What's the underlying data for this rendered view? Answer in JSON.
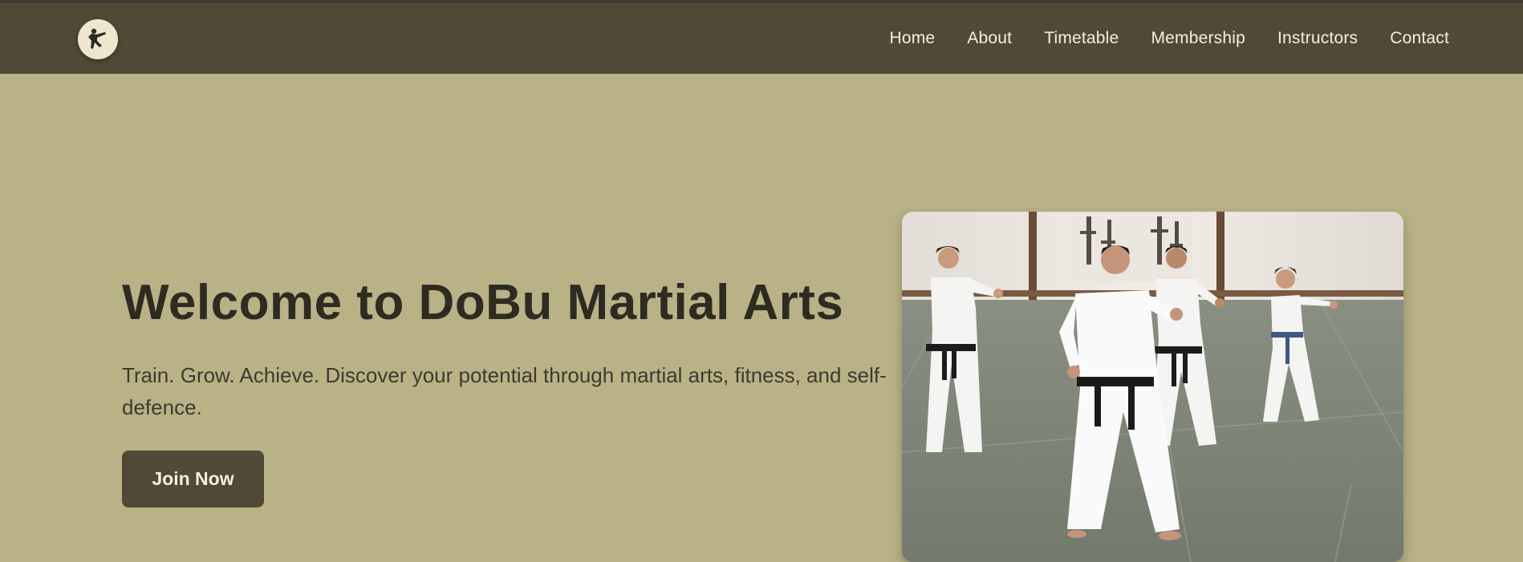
{
  "brand": {
    "logo_icon": "martial-artist-kick-icon"
  },
  "nav": {
    "items": [
      {
        "label": "Home"
      },
      {
        "label": "About"
      },
      {
        "label": "Timetable"
      },
      {
        "label": "Membership"
      },
      {
        "label": "Instructors"
      },
      {
        "label": "Contact"
      }
    ]
  },
  "hero": {
    "title": "Welcome to DoBu Martial Arts",
    "subtitle": "Train. Grow. Achieve. Discover your potential through martial arts, fitness, and self-defence.",
    "cta_label": "Join Now",
    "image_alt": "students-practicing-punches-in-dojo"
  },
  "colors": {
    "header_bg": "#4f4936",
    "page_bg": "#b9b287",
    "title_text": "#2e2b21",
    "button_bg": "#4f4936",
    "nav_text": "#f4efdf"
  }
}
